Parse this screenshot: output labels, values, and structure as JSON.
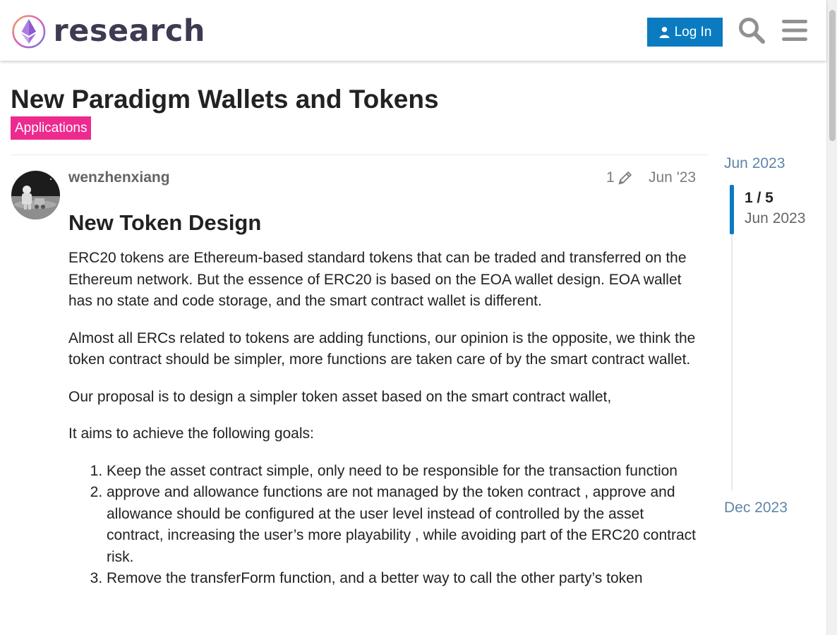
{
  "header": {
    "logo_text": "research",
    "login_label": "Log In",
    "search_icon": "search-icon",
    "menu_icon": "hamburger-menu-icon"
  },
  "topic": {
    "title": "New Paradigm Wallets and Tokens",
    "category": "Applications",
    "category_color": "#ee2a8f"
  },
  "post": {
    "username": "wenzhenxiang",
    "edit_count": "1",
    "date": "Jun '23",
    "heading": "New Token Design",
    "paragraphs": [
      "ERC20 tokens are Ethereum-based standard tokens that can be traded and transferred on the Ethereum network. But the essence of ERC20 is based on the EOA wallet design. EOA wallet has no state and code storage, and the smart contract wallet is different.",
      "Almost all ERCs related to tokens are adding functions, our opinion is the opposite, we think the token contract should be simpler, more functions are taken care of by the smart contract wallet.",
      "Our proposal is to design a simpler token asset based on the smart contract wallet,",
      "It aims to achieve the following goals:"
    ],
    "goals": [
      "Keep the asset contract simple, only need to be responsible for the transaction function",
      "approve and allowance functions are not managed by the token contract , approve and allowance should be configured at the user level instead of controlled by the asset contract, increasing the user’s more playability , while avoiding part of the ERC20 contract risk.",
      "Remove the transferForm function, and a better way to call the other party’s token"
    ]
  },
  "timeline": {
    "start": "Jun 2023",
    "position": "1 / 5",
    "position_date": "Jun 2023",
    "end": "Dec 2023"
  },
  "colors": {
    "accent": "#0a7bc1",
    "timeline_link": "#5f85a8"
  }
}
